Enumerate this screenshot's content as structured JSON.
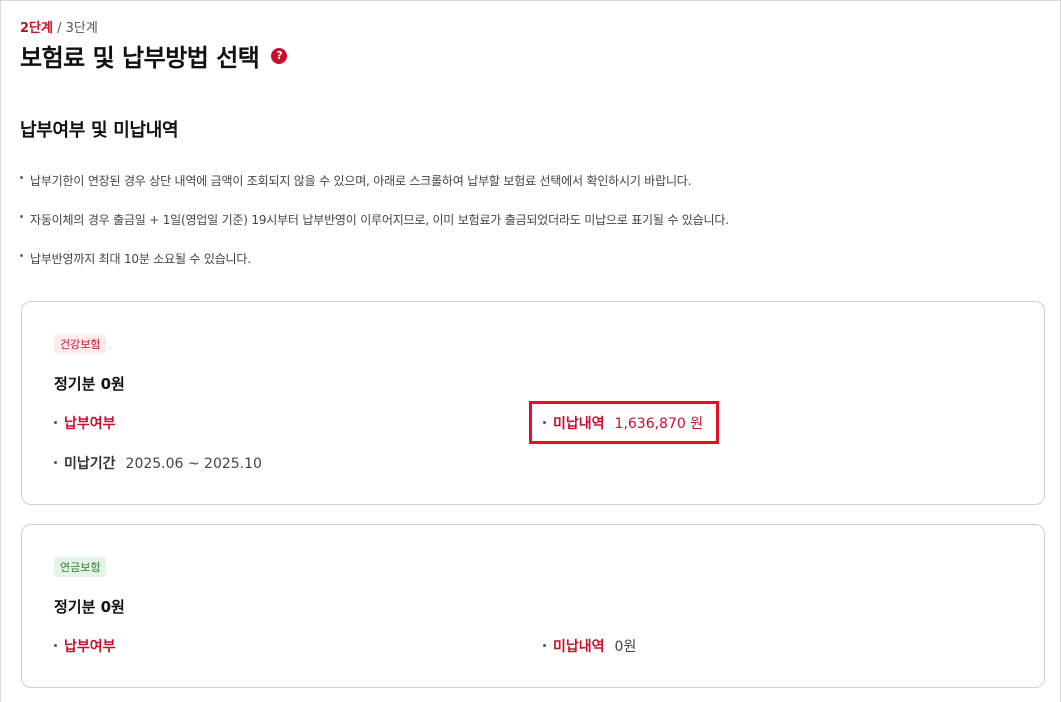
{
  "step": {
    "current": "2단계",
    "separator": " / ",
    "total": "3단계"
  },
  "page_title": "보험료 및 납부방법 선택",
  "help_icon": "question-mark",
  "section_title": "납부여부 및 미납내역",
  "notices": [
    "납부기한이 연장된 경우 상단 내역에 금액이 조회되지 않을 수 있으며, 아래로 스크롤하여 납부할 보험료 선택에서 확인하시기 바랍니다.",
    "자동이체의 경우 출금일 + 1일(영업일 기준) 19시부터 납부반영이 이루어지므로, 이미 보험료가 출금되었더라도 미납으로 표기될 수 있습니다.",
    "납부반영까지 최대 10분 소요될 수 있습니다."
  ],
  "cards": [
    {
      "badge": "건강보험",
      "title": "정기분 0원",
      "payment_status_label": "납부여부",
      "unpaid_label": "미납내역",
      "unpaid_value": "1,636,870 원",
      "period_label": "미납기간",
      "period_value": "2025.06 ~ 2025.10"
    },
    {
      "badge": "연금보험",
      "title": "정기분 0원",
      "payment_status_label": "납부여부",
      "unpaid_label": "미납내역",
      "unpaid_value": "0원"
    }
  ],
  "colors": {
    "accent": "#c8102e",
    "highlight_box": "#e0102b",
    "pension_badge_bg": "#e6f4e8"
  }
}
